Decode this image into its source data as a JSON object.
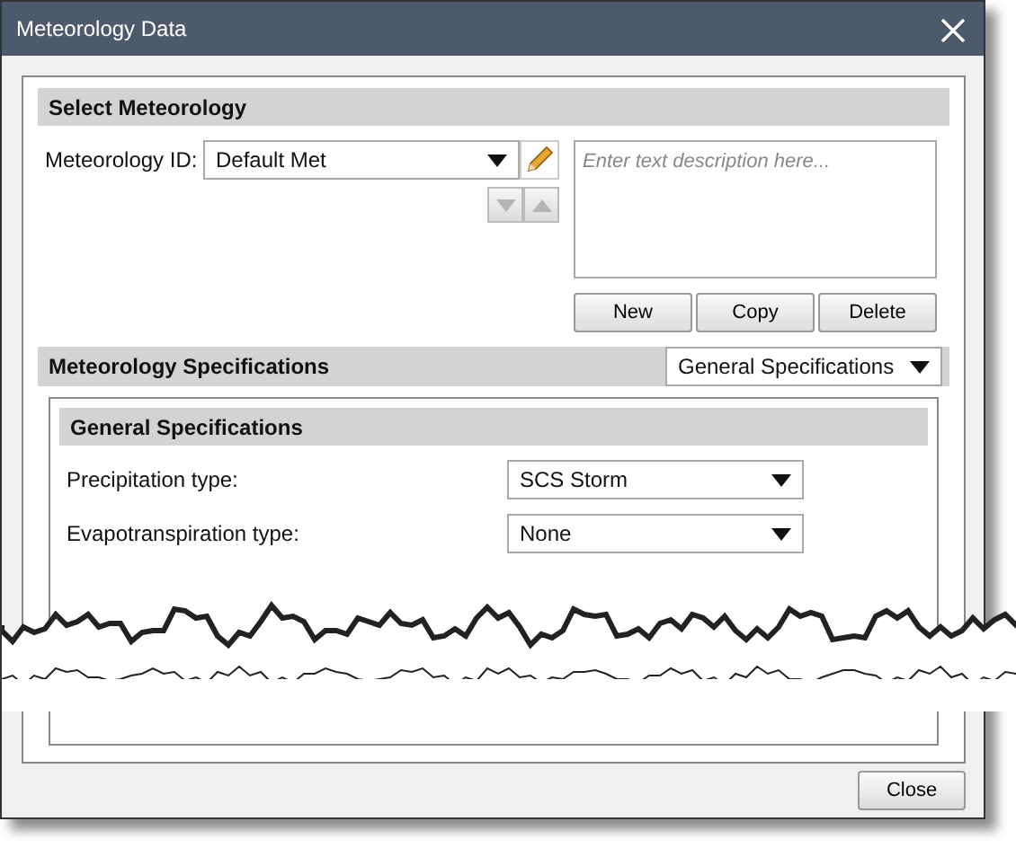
{
  "window": {
    "title": "Meteorology Data"
  },
  "select_meteorology": {
    "heading": "Select Meteorology",
    "id_label": "Meteorology ID:",
    "id_value": "Default Met",
    "move_buttons": [
      {
        "kind": "down",
        "disabled": true
      },
      {
        "kind": "up",
        "disabled": true
      }
    ],
    "description": {
      "placeholder": "Enter text description here..."
    },
    "buttons": [
      "New",
      "Copy",
      "Delete"
    ]
  },
  "specifications": {
    "heading": "Meteorology Specifications",
    "selector": "General Specifications",
    "panel": {
      "heading": "General Specifications",
      "fields": [
        {
          "label": "Precipitation type:",
          "value": "SCS Storm"
        },
        {
          "label": "Evapotranspiration type:",
          "value": "None"
        }
      ]
    }
  },
  "footer": {
    "buttons": [
      "Close"
    ]
  }
}
